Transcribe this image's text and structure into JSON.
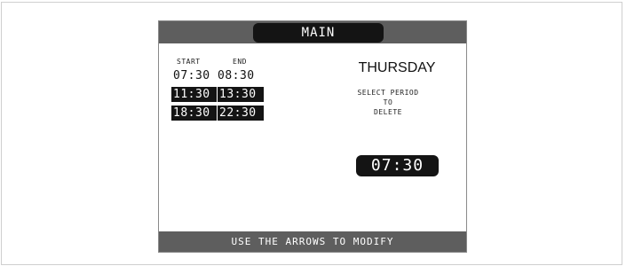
{
  "header": {
    "title": "MAIN"
  },
  "schedule": {
    "start_label": "START",
    "end_label": "END",
    "periods": [
      {
        "start": "07:30",
        "end": "08:30"
      },
      {
        "start": "11:30",
        "end": "13:30"
      },
      {
        "start": "18:30",
        "end": "22:30"
      }
    ]
  },
  "day": "THURSDAY",
  "instruction": {
    "line1": "SELECT PERIOD",
    "line2": "TO",
    "line3": "DELETE"
  },
  "selected_value": "07:30",
  "footer": {
    "hint": "USE THE ARROWS TO MODIFY"
  }
}
